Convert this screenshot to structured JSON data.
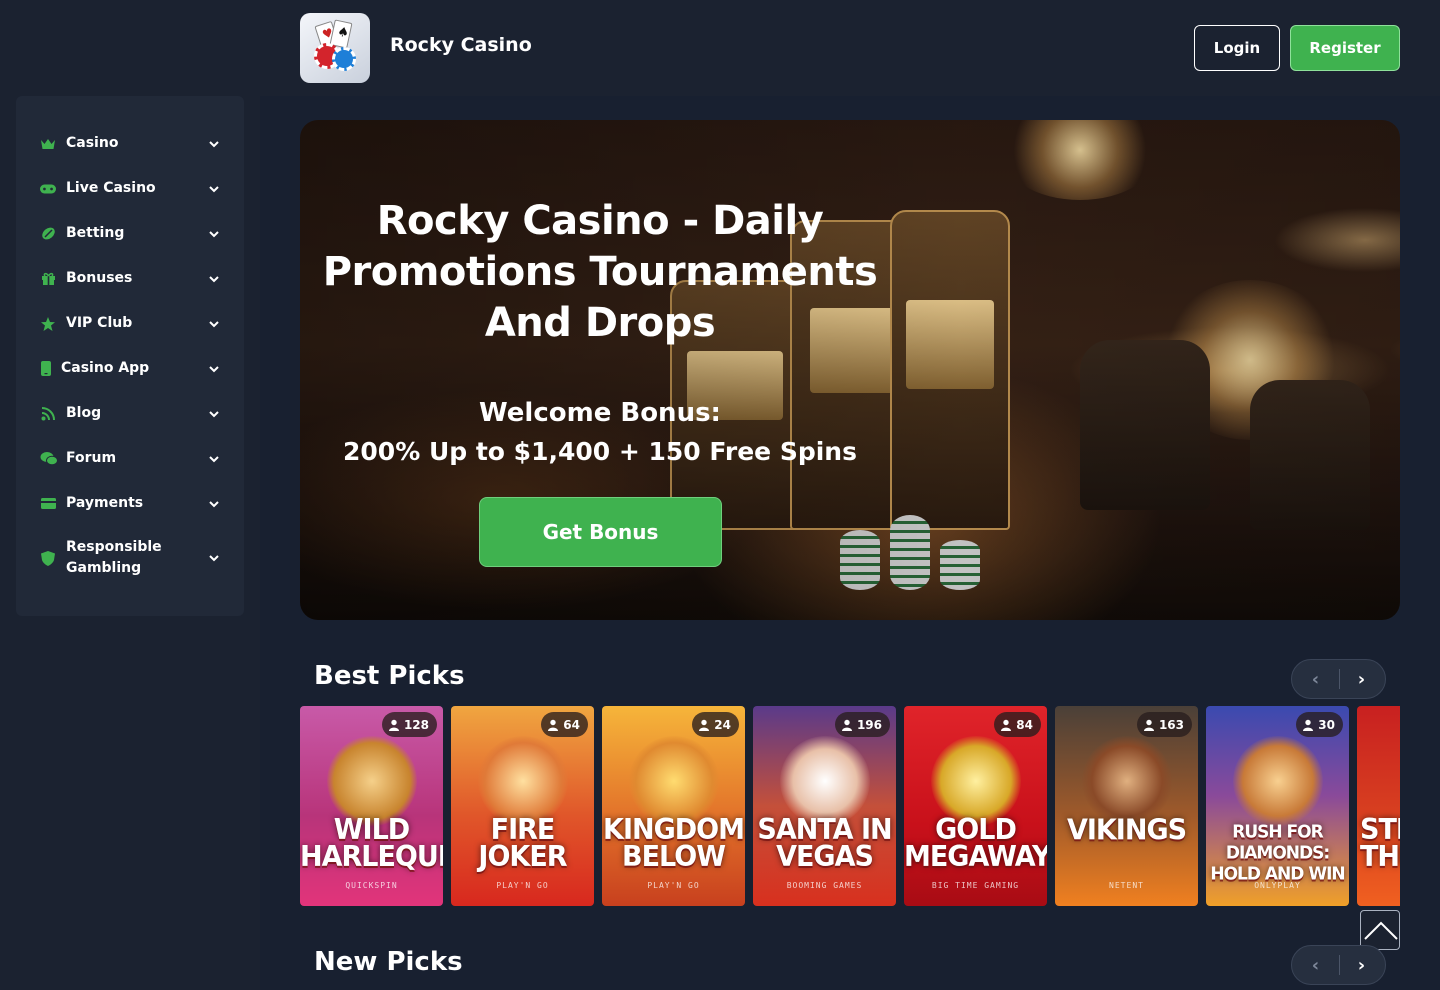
{
  "header": {
    "brand": "Rocky Casino",
    "login_label": "Login",
    "register_label": "Register"
  },
  "sidebar": {
    "items": [
      {
        "label": "Casino",
        "icon": "crown-icon"
      },
      {
        "label": "Live Casino",
        "icon": "gamepad-icon"
      },
      {
        "label": "Betting",
        "icon": "ball-icon"
      },
      {
        "label": "Bonuses",
        "icon": "gift-icon"
      },
      {
        "label": "VIP Club",
        "icon": "star-icon"
      },
      {
        "label": "Casino App",
        "icon": "phone-icon"
      },
      {
        "label": "Blog",
        "icon": "rss-icon"
      },
      {
        "label": "Forum",
        "icon": "chat-icon"
      },
      {
        "label": "Payments",
        "icon": "card-icon"
      },
      {
        "label": "Responsible Gambling",
        "icon": "shield-icon"
      }
    ]
  },
  "hero": {
    "title": "Rocky Casino - Daily Promotions Tournaments And Drops",
    "subtitle_line1": "Welcome Bonus:",
    "subtitle_line2": "200% Up to $1,400 + 150 Free Spins",
    "cta_label": "Get Bonus"
  },
  "best_picks": {
    "title": "Best Picks",
    "prev": "‹",
    "next": "›",
    "games": [
      {
        "name": "WILD HARLEQUIN",
        "provider": "QUICKSPIN",
        "players": "128"
      },
      {
        "name": "FIRE JOKER",
        "provider": "PLAY'N GO",
        "players": "64"
      },
      {
        "name": "KINGDOM BELOW",
        "provider": "PLAY'N GO",
        "players": "24"
      },
      {
        "name": "SANTA IN VEGAS",
        "provider": "BOOMING GAMES",
        "players": "196"
      },
      {
        "name": "GOLD MEGAWAYS",
        "provider": "BIG TIME GAMING",
        "players": "84"
      },
      {
        "name": "VIKINGS",
        "provider": "NETENT",
        "players": "163"
      },
      {
        "name": "RUSH FOR DIAMONDS: HOLD AND WIN",
        "provider": "ONLYPLAY",
        "players": "30"
      },
      {
        "name": "STICKY THUNDER",
        "provider": "",
        "players": ""
      }
    ]
  },
  "new_picks": {
    "title": "New Picks",
    "prev": "‹",
    "next": "›"
  },
  "colors": {
    "accent": "#3fb24f",
    "background": "#1b2230",
    "sidebar": "#212938"
  }
}
